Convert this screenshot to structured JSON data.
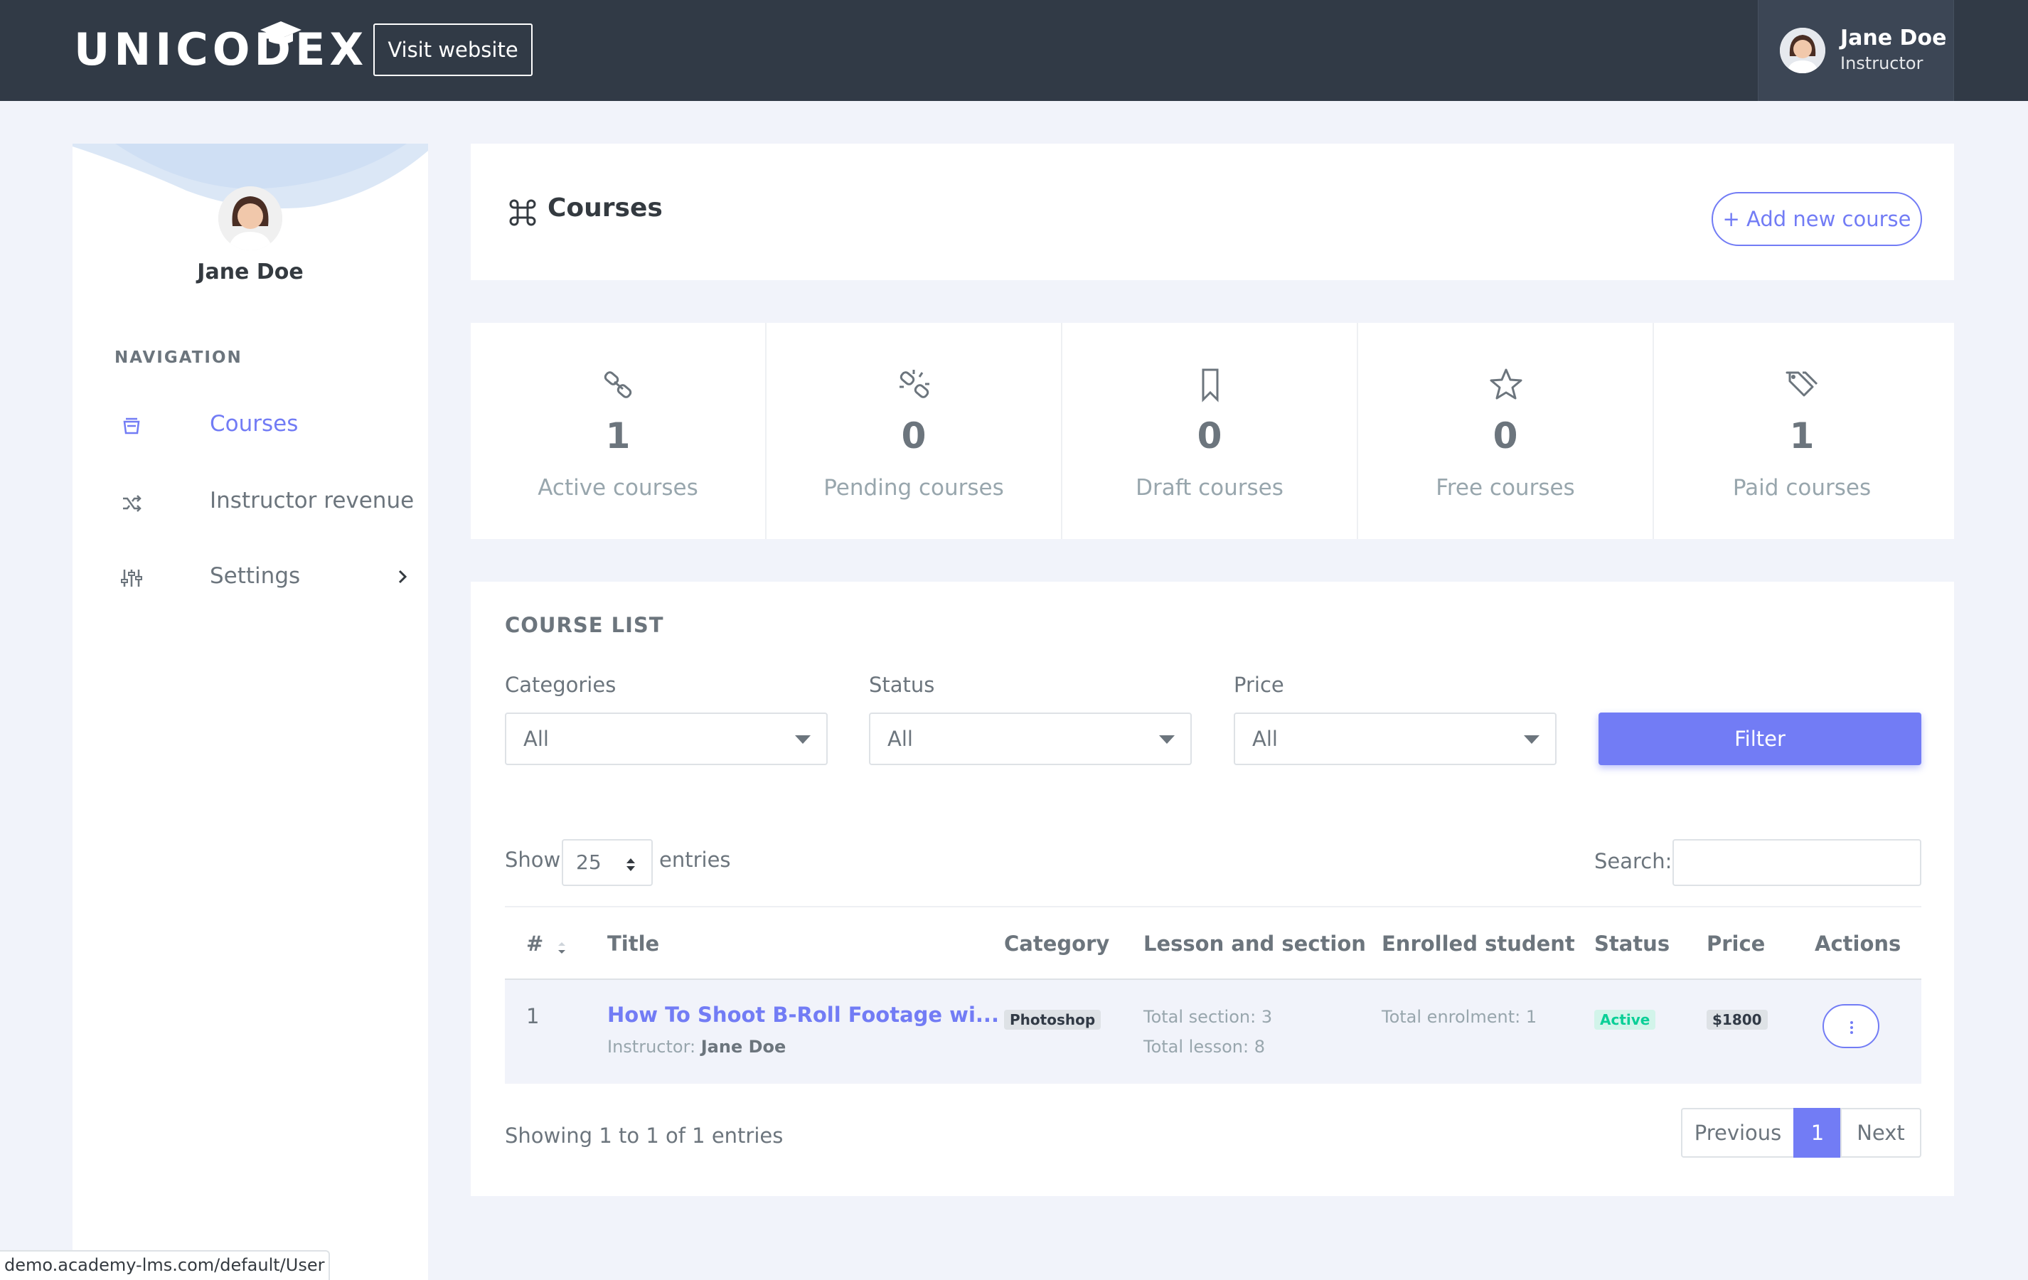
{
  "topbar": {
    "logo_text": "UNICODEX",
    "visit_label": "Visit website",
    "user_name": "Jane Doe",
    "user_role": "Instructor"
  },
  "sidebar": {
    "user_name": "Jane Doe",
    "nav_title": "NAVIGATION",
    "items": [
      {
        "label": "Courses",
        "icon": "courses-icon",
        "active": true
      },
      {
        "label": "Instructor revenue",
        "icon": "shuffle-icon",
        "active": false
      },
      {
        "label": "Settings",
        "icon": "sliders-icon",
        "active": false
      }
    ]
  },
  "header": {
    "title": "Courses",
    "add_label": "+ Add new course"
  },
  "stats": [
    {
      "value": "1",
      "label": "Active courses",
      "icon": "link-icon"
    },
    {
      "value": "0",
      "label": "Pending courses",
      "icon": "broken-link-icon"
    },
    {
      "value": "0",
      "label": "Draft courses",
      "icon": "bookmark-icon"
    },
    {
      "value": "0",
      "label": "Free courses",
      "icon": "star-icon"
    },
    {
      "value": "1",
      "label": "Paid courses",
      "icon": "tags-icon"
    }
  ],
  "course_list": {
    "title": "COURSE LIST",
    "filters": {
      "categories_label": "Categories",
      "categories_value": "All",
      "status_label": "Status",
      "status_value": "All",
      "price_label": "Price",
      "price_value": "All",
      "filter_button": "Filter"
    },
    "show_label": "Show",
    "entries_value": "25",
    "entries_label": "entries",
    "search_label": "Search:",
    "search_value": "",
    "columns": [
      "#",
      "Title",
      "Category",
      "Lesson and section",
      "Enrolled student",
      "Status",
      "Price",
      "Actions"
    ],
    "rows": [
      {
        "index": "1",
        "title": "How To Shoot B-Roll Footage wi...",
        "instructor_label": "Instructor:",
        "instructor_name": "Jane Doe",
        "category": "Photoshop",
        "sections": "Total section: 3",
        "lessons": "Total lesson: 8",
        "enrolment": "Total enrolment: 1",
        "status": "Active",
        "price": "$1800"
      }
    ],
    "showing_text": "Showing 1 to 1 of 1 entries",
    "pagination": {
      "previous": "Previous",
      "current": "1",
      "next": "Next"
    }
  },
  "status_bar": {
    "url": "demo.academy-lms.com/default/User"
  },
  "colors": {
    "topbar": "#313a46",
    "primary": "#727cf5",
    "success": "#0acf97",
    "background": "#f1f3fa"
  }
}
